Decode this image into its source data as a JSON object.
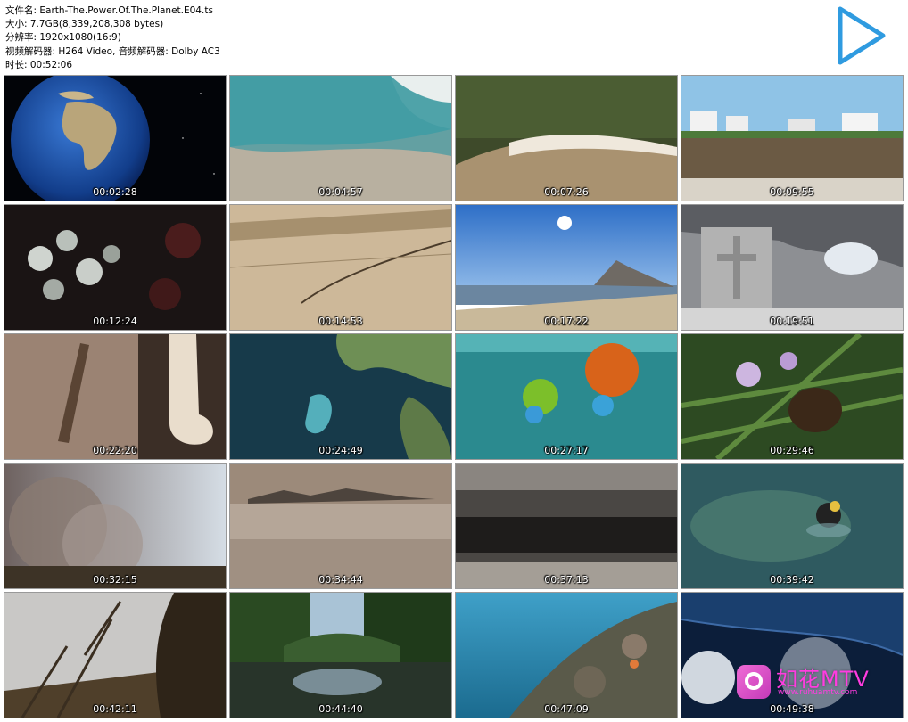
{
  "header": {
    "filename": "文件名: Earth-The.Power.Of.The.Planet.E04.ts",
    "size": "大小: 7.7GB(8,339,208,308 bytes)",
    "resolution": "分辨率: 1920x1080(16:9)",
    "codecs": "视频解码器: H264 Video, 音频解码器: Dolby AC3",
    "duration": "时长: 00:52:06"
  },
  "thumbnails": [
    {
      "time": "00:02:28",
      "scene": "earth"
    },
    {
      "time": "00:04:57",
      "scene": "wave"
    },
    {
      "time": "00:07:26",
      "scene": "flood"
    },
    {
      "time": "00:09:55",
      "scene": "houses"
    },
    {
      "time": "00:12:24",
      "scene": "plants"
    },
    {
      "time": "00:14:53",
      "scene": "desert"
    },
    {
      "time": "00:17:22",
      "scene": "gibraltar"
    },
    {
      "time": "00:19:51",
      "scene": "cave"
    },
    {
      "time": "00:22:20",
      "scene": "bones"
    },
    {
      "time": "00:24:49",
      "scene": "bloom"
    },
    {
      "time": "00:27:17",
      "scene": "ink"
    },
    {
      "time": "00:29:46",
      "scene": "bee"
    },
    {
      "time": "00:32:15",
      "scene": "smoke"
    },
    {
      "time": "00:34:44",
      "scene": "sea-haze"
    },
    {
      "time": "00:37:13",
      "scene": "rock"
    },
    {
      "time": "00:39:42",
      "scene": "diver"
    },
    {
      "time": "00:42:11",
      "scene": "branches"
    },
    {
      "time": "00:44:40",
      "scene": "lake"
    },
    {
      "time": "00:47:09",
      "scene": "reef"
    },
    {
      "time": "00:49:38",
      "scene": "earth-cloud"
    }
  ],
  "watermark": {
    "brand": "如花MTV",
    "url": "www.ruhuamtv.com"
  },
  "colors": {
    "play_icon": "#2f9be0",
    "watermark": "#ff3ce0"
  }
}
